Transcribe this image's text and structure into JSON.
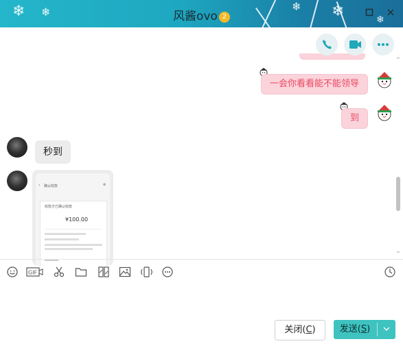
{
  "window": {
    "title": "风酱ovo",
    "badge": "2",
    "controls": [
      "minimize-icon",
      "maximize-icon",
      "close-icon"
    ]
  },
  "header_actions": [
    {
      "name": "voice-call-button",
      "icon": "phone-icon"
    },
    {
      "name": "video-call-button",
      "icon": "video-camera-icon"
    },
    {
      "name": "more-button",
      "icon": "more-icon"
    }
  ],
  "messages": {
    "out_1": "一会你看看能不能领导",
    "out_2": "到",
    "in_1": "秒到"
  },
  "screenshot_preview": {
    "header_title": "确认收款",
    "status_line": "收款方已确认收款",
    "amount": "¥100.00"
  },
  "toolbar": {
    "items": [
      "emoji-icon",
      "gif-icon",
      "scissors-icon",
      "folder-icon",
      "image-library-icon",
      "image-icon",
      "shake-icon",
      "more-icon",
      "history-icon"
    ],
    "gif_label": "GIF"
  },
  "footer": {
    "close_label": "关闭",
    "close_key": "C",
    "send_label": "发送",
    "send_key": "S"
  },
  "colors": {
    "title_bar": "#1ea7c0",
    "accent": "#3ec3c0",
    "bubble_out": "#fbd3db",
    "bubble_out_text": "#e84a63",
    "bubble_in": "#ececec"
  }
}
